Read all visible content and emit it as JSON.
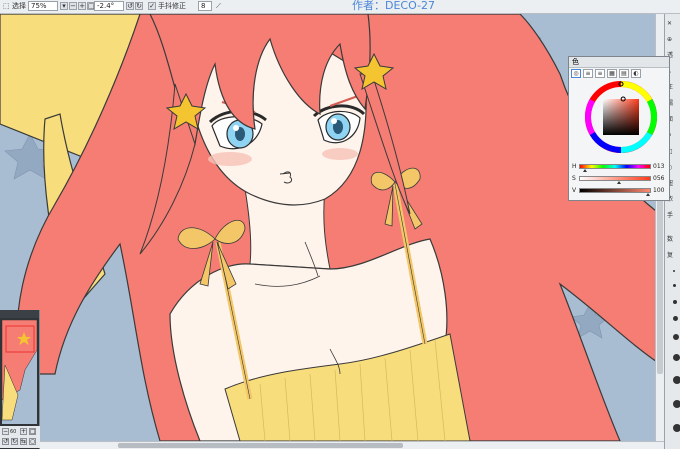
{
  "toolbar": {
    "select_label": "选择",
    "zoom_value": "75%",
    "rotation_value": "-2.4°",
    "stabilizer_label": "手抖修正",
    "stabilizer_value": "8"
  },
  "window": {
    "title": "作者：DECO-27"
  },
  "color_panel": {
    "title": "色",
    "h_label": "H",
    "h_value": "013",
    "s_label": "S",
    "s_value": "056",
    "v_label": "V",
    "v_value": "100",
    "h_level": 0.04,
    "s_level": 0.56,
    "v_level": 1.0,
    "current_color": "#ff8a70"
  },
  "right_panel": {
    "items": [
      "✕",
      "⊕",
      "透",
      "↓",
      "正",
      "漏",
      "面",
      "↵",
      "□",
      "○",
      "钮",
      "浓",
      "手",
      "数",
      "复"
    ]
  },
  "navigator": {
    "zoom_label": "60"
  },
  "colors": {
    "hair": "#f57d73",
    "skin": "#fff4ec",
    "background_blue": "#a9bdd2",
    "yellow": "#f7dd7c",
    "ribbon": "#f3c767",
    "eye": "#8fd4f2",
    "star": "#f5c531"
  }
}
